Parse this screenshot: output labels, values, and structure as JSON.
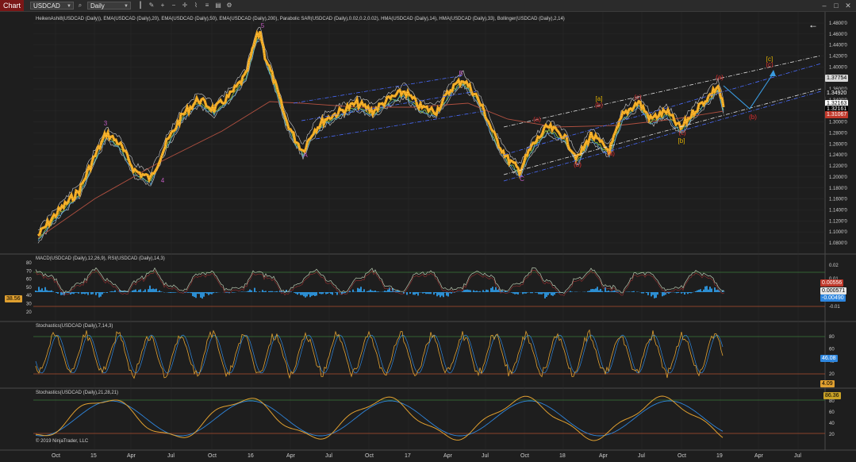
{
  "toolbar": {
    "chart_tab": "Chart",
    "instrument": "USDCAD",
    "interval": "Daily",
    "icons": [
      "search-icon",
      "bar-style-icon",
      "drawing-tools-icon",
      "zoom-in-icon",
      "zoom-out-icon",
      "crosshair-icon",
      "indicators-icon",
      "strategies-icon",
      "properties-icon",
      "settings-icon"
    ],
    "window_icons": [
      "minimize-icon",
      "maximize-icon",
      "close-icon"
    ]
  },
  "panels": {
    "price_label": "HeikenAshi8(USDCAD (Daily)), EMA(USDCAD (Daily),20), EMA(USDCAD (Daily),50), EMA(USDCAD (Daily),200), Parabolic SAR(USDCAD (Daily),0.02,0.2,0.02), HMA(USDCAD (Daily),14), HMA(USDCAD (Daily),33), Bollinger(USDCAD (Daily),2,14)",
    "macd_label": "MACD(USDCAD (Daily),12,26,9), RSI(USDCAD (Daily),14,3)",
    "stoch1_label": "Stochastics(USDCAD (Daily),7,14,3)",
    "stoch2_label": "Stochastics(USDCAD (Daily),21,28,21)",
    "copyright": "© 2019 NinjaTrader, LLC",
    "back_arrow": "←"
  },
  "price_axis": [
    "1.4800'0",
    "1.4600'0",
    "1.4400'0",
    "1.4200'0",
    "1.4000'0",
    "1.3800'0",
    "1.3600'0",
    "1.3400'0",
    "1.3200'0",
    "1.3000'0",
    "1.2800'0",
    "1.2600'0",
    "1.2400'0",
    "1.2200'0",
    "1.2000'0",
    "1.1800'0",
    "1.1600'0",
    "1.1400'0",
    "1.1200'0",
    "1.1000'0",
    "1.0800'0"
  ],
  "price_tags": [
    {
      "text": "1.37754",
      "bg": "#d9d9d9",
      "fg": "#000000"
    },
    {
      "text": "1.34920",
      "bg": "#1e1e1e",
      "fg": "#ffffff"
    },
    {
      "text": "1.32163",
      "bg": "#ffffff",
      "fg": "#000000"
    },
    {
      "text": "1.32161",
      "bg": "#000000",
      "fg": "#ffffff"
    },
    {
      "text": "1.31067",
      "bg": "#c0392b",
      "fg": "#ffffff"
    }
  ],
  "macd_axis_left": [
    "80",
    "70",
    "60",
    "50",
    "40",
    "30",
    "20"
  ],
  "macd_axis_right": [
    "0.02",
    "0.01",
    "0",
    "-0.01"
  ],
  "macd_tags": [
    {
      "text": "38.56",
      "bg": "#e0a030",
      "fg": "#000000"
    },
    {
      "text": "0.00556",
      "bg": "#c0392b",
      "fg": "#ffffff"
    },
    {
      "text": "0.000571",
      "bg": "#e8e8e8",
      "fg": "#000000"
    },
    {
      "text": "-0.00490",
      "bg": "#2e86de",
      "fg": "#ffffff"
    }
  ],
  "stoch1_axis": [
    "80",
    "60",
    "40",
    "20"
  ],
  "stoch1_tags": [
    {
      "text": "46.08",
      "bg": "#2e86de",
      "fg": "#ffffff"
    },
    {
      "text": "4.09",
      "bg": "#e0a030",
      "fg": "#000000"
    }
  ],
  "stoch2_axis": [
    "80",
    "60",
    "40",
    "20"
  ],
  "stoch2_tags": [
    {
      "text": "86.36",
      "bg": "#c9a227",
      "fg": "#000000"
    }
  ],
  "x_axis": [
    "Oct",
    "15",
    "Apr",
    "Jul",
    "Oct",
    "16",
    "Apr",
    "Jul",
    "Oct",
    "17",
    "Apr",
    "Jul",
    "Oct",
    "18",
    "Apr",
    "Jul",
    "Oct",
    "19",
    "Apr",
    "Jul"
  ],
  "wave_labels": [
    {
      "text": "3",
      "color": "#c05ac0"
    },
    {
      "text": "4",
      "color": "#c05ac0"
    },
    {
      "text": "5",
      "color": "#c05ac0"
    },
    {
      "text": "A",
      "color": "#c05ac0"
    },
    {
      "text": "B",
      "color": "#c05ac0"
    },
    {
      "text": "C",
      "color": "#c05ac0"
    },
    {
      "text": "(a)",
      "color": "#e03030"
    },
    {
      "text": "(b)",
      "color": "#e03030"
    },
    {
      "text": "(a)",
      "color": "#e03030"
    },
    {
      "text": "(b)",
      "color": "#e03030"
    },
    {
      "text": "(c)",
      "color": "#e03030"
    },
    {
      "text": "[a]",
      "color": "#e0b000"
    },
    {
      "text": "(c)",
      "color": "#e03030"
    },
    {
      "text": "[b]",
      "color": "#e0b000"
    },
    {
      "text": "(a)",
      "color": "#e03030"
    },
    {
      "text": "(b)",
      "color": "#e03030"
    },
    {
      "text": "[c]",
      "color": "#e0b000"
    },
    {
      "text": "(c)",
      "color": "#e03030"
    }
  ],
  "colors": {
    "background": "#1e1e1e",
    "ha_candle": "#f0a820",
    "ema20": "#8fbf3f",
    "ema200": "#b05040",
    "bollinger": "#cfcfcf",
    "channel_blue": "#4a6cff",
    "channel_white": "#e0e0e0",
    "rsi": "#9acd32",
    "macd_hist": "#2e9be6",
    "stoch_k": "#e0a030",
    "stoch_d": "#2e86de",
    "overbought_line": "#3a7a3a",
    "oversold_line": "#b05030"
  }
}
